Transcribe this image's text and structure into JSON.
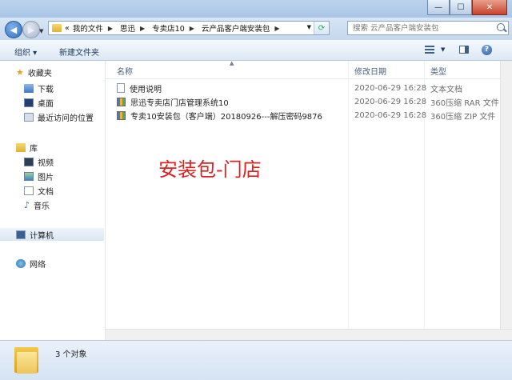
{
  "window": {
    "controls": {
      "minimize": "—",
      "maximize": "☐",
      "close": "✕"
    }
  },
  "nav": {
    "back_glyph": "◀",
    "forward_glyph": "▶",
    "breadcrumb_prefix": "«",
    "breadcrumbs": [
      "我的文件",
      "思迅",
      "专卖店10",
      "云产品客户端安装包"
    ],
    "search_placeholder": "搜索 云产品客户端安装包"
  },
  "toolbar": {
    "organize": "组织",
    "new_folder": "新建文件夹",
    "help_glyph": "?"
  },
  "sidebar": {
    "favorites": {
      "label": "收藏夹",
      "items": [
        "下载",
        "桌面",
        "最近访问的位置"
      ]
    },
    "libraries": {
      "label": "库",
      "items": [
        "视频",
        "图片",
        "文档",
        "音乐"
      ]
    },
    "computer": "计算机",
    "network": "网络"
  },
  "columns": {
    "name": "名称",
    "modified": "修改日期",
    "type": "类型"
  },
  "files": [
    {
      "name": "使用说明",
      "modified": "2020-06-29 16:28",
      "type": "文本文档",
      "icon": "text-file-icon"
    },
    {
      "name": "思迅专卖店门店管理系统10",
      "modified": "2020-06-29 16:28",
      "type": "360压缩 RAR 文件",
      "icon": "rar-archive-icon"
    },
    {
      "name": "专卖10安装包（客户端）20180926---解压密码9876",
      "modified": "2020-06-29 16:28",
      "type": "360压缩 ZIP 文件",
      "icon": "zip-archive-icon"
    }
  ],
  "annotation": "安装包-门店",
  "status": {
    "count": "3 个对象"
  },
  "colors": {
    "annotation": "#e02020",
    "window_frame": "#cfe0f3"
  }
}
